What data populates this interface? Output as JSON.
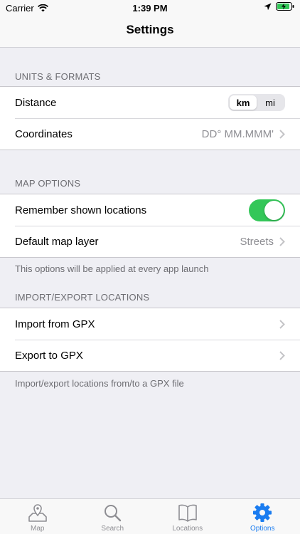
{
  "status": {
    "carrier": "Carrier",
    "time": "1:39 PM"
  },
  "nav": {
    "title": "Settings"
  },
  "units": {
    "header": "UNITS & FORMATS",
    "distance_label": "Distance",
    "distance_options": [
      "km",
      "mi"
    ],
    "distance_selected": "km",
    "coordinates_label": "Coordinates",
    "coordinates_value": "DD° MM.MMM'"
  },
  "map_options": {
    "header": "MAP OPTIONS",
    "remember_label": "Remember shown locations",
    "remember_on": true,
    "layer_label": "Default map layer",
    "layer_value": "Streets",
    "footer": "This options will be applied at every app launch"
  },
  "import_export": {
    "header": "IMPORT/EXPORT LOCATIONS",
    "import_label": "Import from GPX",
    "export_label": "Export to GPX",
    "footer": "Import/export locations from/to a GPX file"
  },
  "tabs": [
    {
      "label": "Map",
      "icon": "map-pin-icon"
    },
    {
      "label": "Search",
      "icon": "magnifier-icon"
    },
    {
      "label": "Locations",
      "icon": "book-icon"
    },
    {
      "label": "Options",
      "icon": "gear-icon"
    }
  ],
  "active_tab": "Options",
  "colors": {
    "accent": "#1a7cf0",
    "toggle_on": "#34c759"
  }
}
